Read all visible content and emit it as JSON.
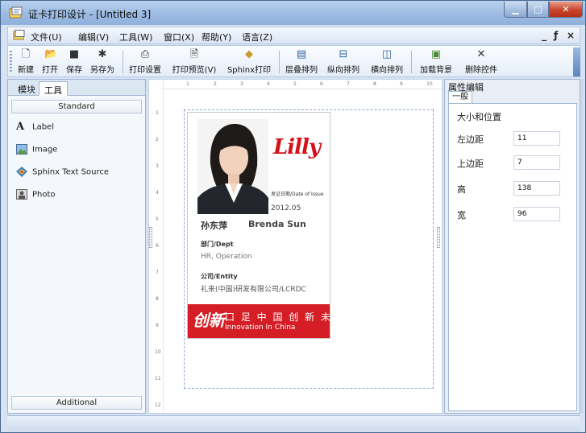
{
  "window": {
    "title": "证卡打印设计 - [Untitled 3]"
  },
  "menubar": {
    "items": [
      "文件(U)",
      "编辑(V)",
      "工具(W)",
      "窗口(X)",
      "帮助(Y)",
      "语言(Z)"
    ]
  },
  "toolbar": {
    "buttons": [
      {
        "label": "新建",
        "icon": "new-doc-icon"
      },
      {
        "label": "打开",
        "icon": "open-folder-icon"
      },
      {
        "label": "保存",
        "icon": "save-icon"
      },
      {
        "label": "另存为",
        "icon": "save-as-icon"
      },
      {
        "label": "打印设置",
        "icon": "print-setup-icon"
      },
      {
        "label": "打印预览(V)",
        "icon": "print-preview-icon"
      },
      {
        "label": "Sphinx打印",
        "icon": "sphinx-print-icon"
      },
      {
        "label": "层叠排列",
        "icon": "cascade-icon"
      },
      {
        "label": "纵向排列",
        "icon": "tile-vertical-icon"
      },
      {
        "label": "横向排列",
        "icon": "tile-horizontal-icon"
      },
      {
        "label": "加载背景",
        "icon": "load-background-icon"
      },
      {
        "label": "删除控件",
        "icon": "delete-icon"
      }
    ]
  },
  "left_panel": {
    "tabs": [
      "模块",
      "工具"
    ],
    "section_top": "Standard",
    "section_bottom": "Additional",
    "items": [
      {
        "label": "Label",
        "icon": "label-a-icon"
      },
      {
        "label": "Image",
        "icon": "image-icon"
      },
      {
        "label": "Sphinx Text Source",
        "icon": "text-source-icon"
      },
      {
        "label": "Photo",
        "icon": "photo-icon"
      }
    ]
  },
  "ruler": {
    "top": [
      "1",
      "2",
      "3",
      "4",
      "5",
      "6",
      "7",
      "8",
      "9",
      "10"
    ],
    "left": [
      "1",
      "2",
      "3",
      "4",
      "5",
      "6",
      "7",
      "8",
      "9",
      "10",
      "11",
      "12"
    ]
  },
  "card": {
    "logo_text": "Lilly",
    "issue_label": "发证日期/Date of Issue",
    "issue_date": "2012.05",
    "name_cn": "孙东萍",
    "name_en": "Brenda Sun",
    "dept_label": "部门/Dept",
    "dept_value": "HR, Operation",
    "entity_label": "公司/Entity",
    "entity_value": "礼来(中国)研发有限公司/LCRDC",
    "banner_logo": "创新",
    "banner_cn": "口 足 中 国  创 新 未 语",
    "banner_en": "Innovation In China",
    "colors": {
      "brand_red": "#d41d25"
    }
  },
  "right_panel": {
    "title": "属性编辑",
    "tab": "一般",
    "group": "大小和位置",
    "fields": [
      {
        "label": "左边距",
        "value": "11"
      },
      {
        "label": "上边距",
        "value": "7"
      },
      {
        "label": "高",
        "value": "138"
      },
      {
        "label": "宽",
        "value": "96"
      }
    ]
  },
  "mdi_controls": [
    "_",
    "♂",
    "×"
  ]
}
